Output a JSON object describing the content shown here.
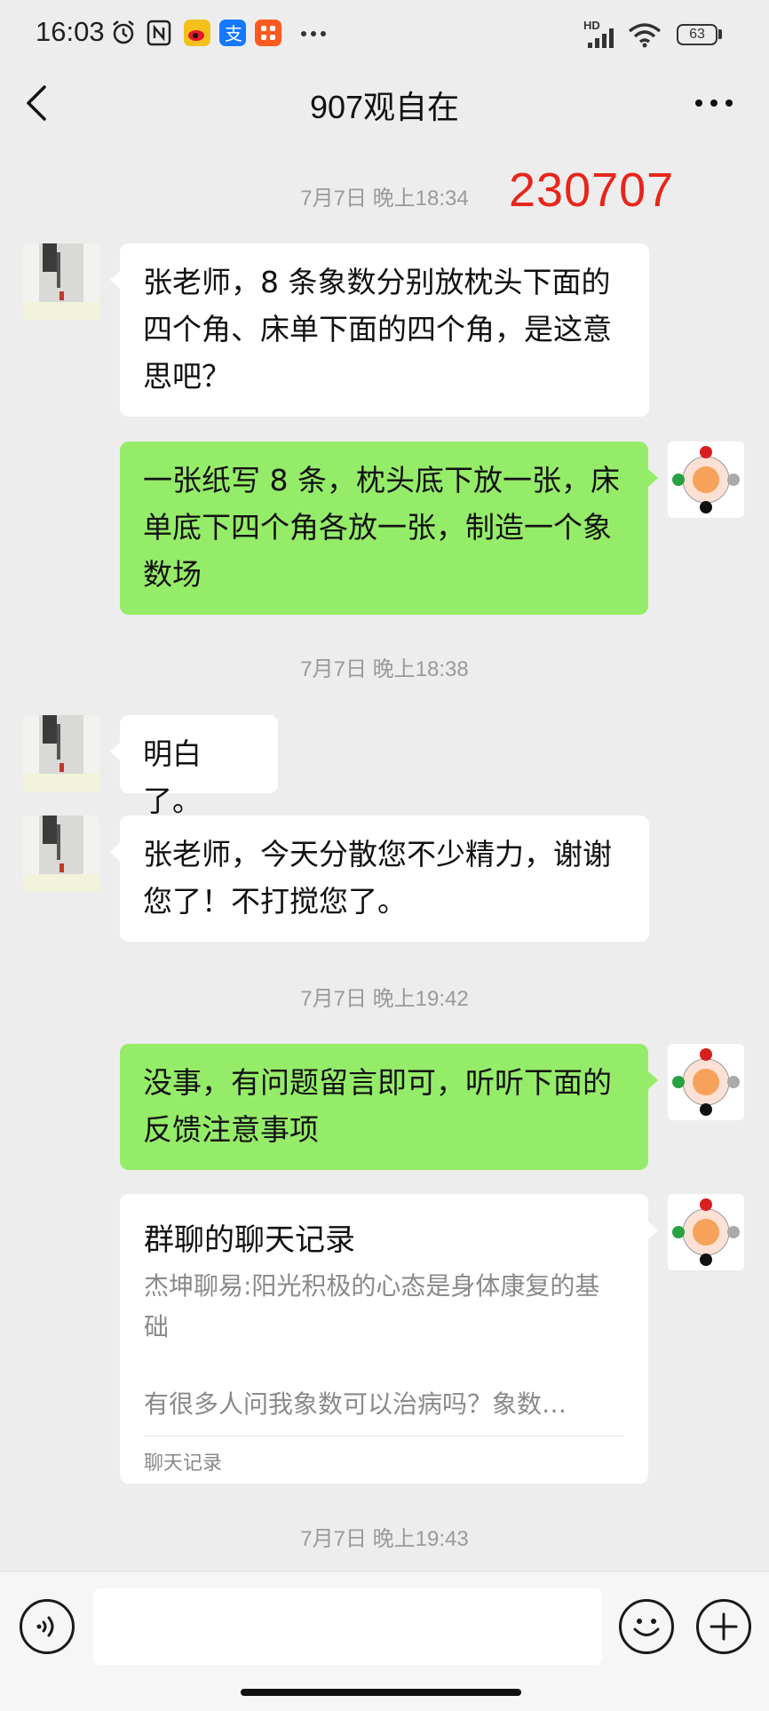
{
  "status_bar": {
    "time": "16:03",
    "network": "HD",
    "battery": "63"
  },
  "header": {
    "title": "907观自在"
  },
  "overlay_number": "230707",
  "messages": {
    "ts1": "7月7日 晚上18:34",
    "m1": "张老师，8 条象数分别放枕头下面的四个角、床单下面的四个角，是这意思吧？",
    "m2": "一张纸写 8 条，枕头底下放一张，床单底下四个角各放一张，制造一个象数场",
    "ts2": "7月7日 晚上18:38",
    "m3": "明白了。",
    "m4": "张老师，今天分散您不少精力，谢谢您了！不打搅您了。",
    "ts3": "7月7日 晚上19:42",
    "m5": "没事，有问题留言即可，听听下面的反馈注意事项",
    "card": {
      "title": "群聊的聊天记录",
      "line1": "杰坤聊易:阳光积极的心态是身体康复的基础",
      "line2": "有很多人问我象数可以治病吗？象数…",
      "footer": "聊天记录"
    },
    "ts4": "7月7日 晚上19:43"
  },
  "colors": {
    "sent_bubble": "#95ec69",
    "received_bubble": "#ffffff",
    "background": "#ededed",
    "overlay_red": "#e8251a"
  }
}
